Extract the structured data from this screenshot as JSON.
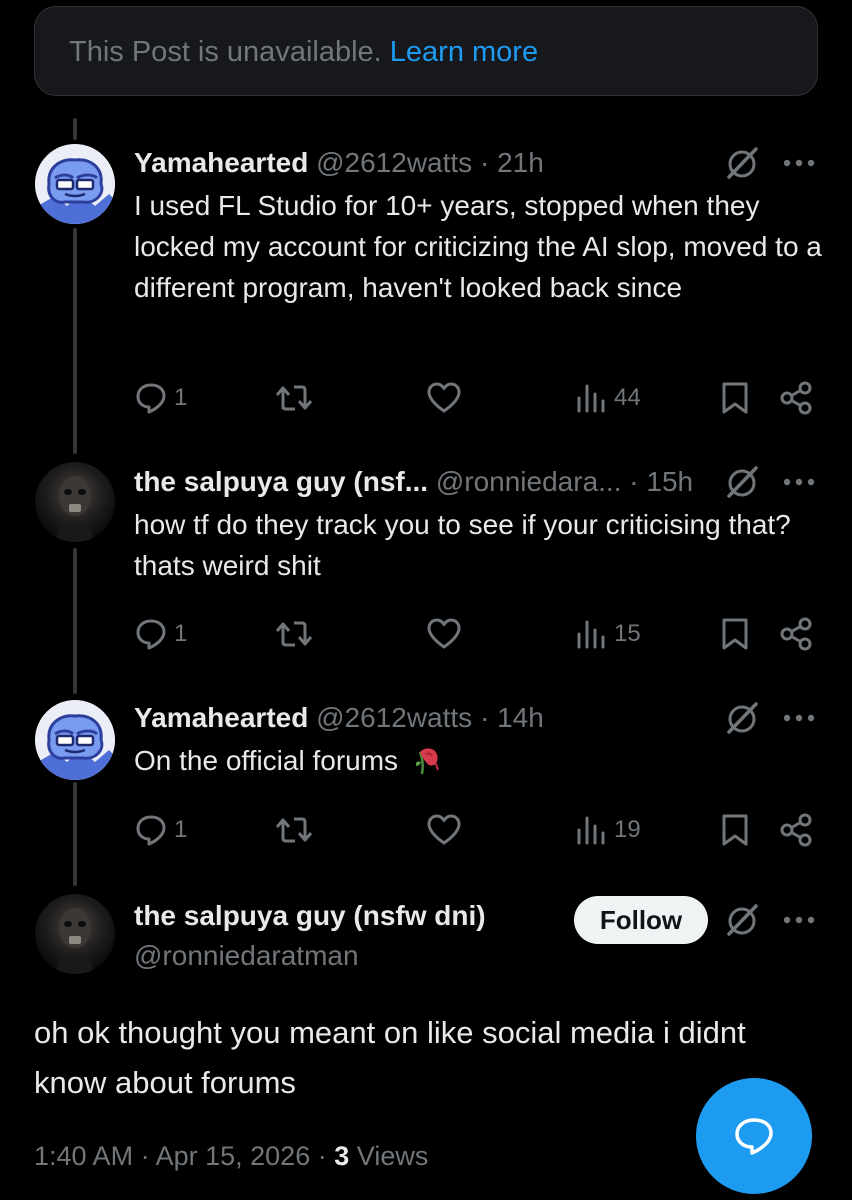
{
  "banner": {
    "text": "This Post is unavailable.",
    "link": "Learn more"
  },
  "replies": [
    {
      "name": "Yamahearted",
      "handle": "@2612watts",
      "sep": "·",
      "time": "21h",
      "text": "I used FL Studio for 10+ years, stopped when they locked my account for criticizing the AI slop, moved to a different program, haven't looked back since",
      "replies": "1",
      "views": "44"
    },
    {
      "name": "the salpuya guy (nsf...",
      "handle": "@ronniedara...",
      "sep": "·",
      "time": "15h",
      "text": "how tf do they track you to see if your criticising that? thats weird shit",
      "replies": "1",
      "views": "15"
    },
    {
      "name": "Yamahearted",
      "handle": "@2612watts",
      "sep": "·",
      "time": "14h",
      "text": "On the official forums",
      "replies": "1",
      "views": "19"
    }
  ],
  "main_post": {
    "name": "the salpuya guy (nsfw dni)",
    "handle": "@ronniedaratman",
    "follow_label": "Follow",
    "text": "oh ok thought you meant on like social media i didnt know about forums",
    "time": "1:40 AM",
    "sep": "·",
    "date": "Apr 15, 2026",
    "views_count": "3",
    "views_label": "Views"
  },
  "icons": {
    "reply": "reply-icon",
    "repost": "repost-icon",
    "like": "heart-icon",
    "views": "views-icon",
    "bookmark": "bookmark-icon",
    "share": "share-icon",
    "grok": "grok-icon",
    "more": "more-icon",
    "compose": "compose-reply-icon",
    "emoji": "wilted-rose-emoji"
  },
  "colors": {
    "accent": "#1d9bf0",
    "muted": "#71767b",
    "text": "#e7e9ea",
    "background": "#000000"
  }
}
